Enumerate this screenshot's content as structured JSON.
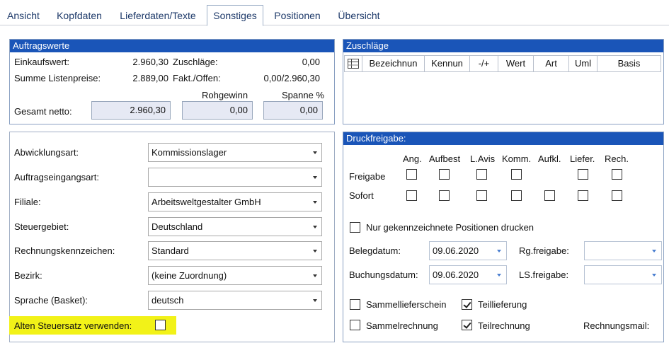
{
  "tabs": [
    "Ansicht",
    "Kopfdaten",
    "Lieferdaten/Texte",
    "Sonstiges",
    "Positionen",
    "Übersicht"
  ],
  "active_tab": "Sonstiges",
  "auftragswerte": {
    "title": "Auftragswerte",
    "einkaufswert_label": "Einkaufswert:",
    "einkaufswert": "2.960,30",
    "zuschlaege_label": "Zuschläge:",
    "zuschlaege": "0,00",
    "summe_label": "Summe Listenpreise:",
    "summe": "2.889,00",
    "fakt_label": "Fakt./Offen:",
    "fakt": "0,00/2.960,30",
    "rohgewinn_label": "Rohgewinn",
    "spanne_label": "Spanne %",
    "gesamt_label": "Gesamt netto:",
    "gesamt": "2.960,30",
    "rohgewinn": "0,00",
    "spanne": "0,00"
  },
  "zuschlaege": {
    "title": "Zuschläge",
    "columns": [
      "Bezeichnun",
      "Kennun",
      "-/+",
      "Wert",
      "Art",
      "Uml",
      "Basis"
    ]
  },
  "form": {
    "fields": [
      {
        "label": "Abwicklungsart:",
        "value": "Kommissionslager"
      },
      {
        "label": "Auftragseingangsart:",
        "value": ""
      },
      {
        "label": "Filiale:",
        "value": "Arbeitsweltgestalter GmbH"
      },
      {
        "label": "Steuergebiet:",
        "value": "Deutschland"
      },
      {
        "label": "Rechnungskennzeichen:",
        "value": "Standard"
      },
      {
        "label": "Bezirk:",
        "value": "(keine Zuordnung)"
      },
      {
        "label": "Sprache (Basket):",
        "value": "deutsch"
      }
    ],
    "alter_steuersatz_label": "Alten Steuersatz verwenden:",
    "alter_steuersatz_checked": false
  },
  "druckfreigabe": {
    "title": "Druckfreigabe:",
    "columns": [
      "Ang.",
      "Aufbest",
      "L.Avis",
      "Komm.",
      "Aufkl.",
      "Liefer.",
      "Rech."
    ],
    "row_freigabe": "Freigabe",
    "row_sofort": "Sofort",
    "nur_gekennzeichnete": "Nur gekennzeichnete Positionen drucken",
    "belegdatum_label": "Belegdatum:",
    "belegdatum": "09.06.2020",
    "buchungsdatum_label": "Buchungsdatum:",
    "buchungsdatum": "09.06.2020",
    "rg_freigabe_label": "Rg.freigabe:",
    "ls_freigabe_label": "LS.freigabe:",
    "sammellieferschein": "Sammellieferschein",
    "teillieferung": "Teillieferung",
    "sammelrechnung": "Sammelrechnung",
    "teilrechnung": "Teilrechnung",
    "rechnungsmail": "Rechnungsmail:"
  },
  "colors": {
    "header_blue": "#1a55b8",
    "highlight": "#f2f218",
    "readonly_bg": "#e6e9f4"
  }
}
